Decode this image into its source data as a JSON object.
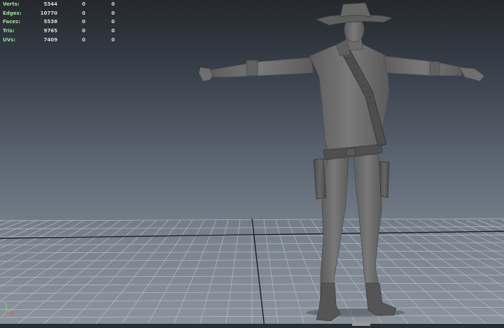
{
  "stats": [
    {
      "label": "Verts:",
      "values": [
        "5344",
        "0",
        "0"
      ]
    },
    {
      "label": "Edges:",
      "values": [
        "10770",
        "0",
        "0"
      ]
    },
    {
      "label": "Faces:",
      "values": [
        "5538",
        "0",
        "0"
      ]
    },
    {
      "label": "Tris:",
      "values": [
        "9765",
        "0",
        "0"
      ]
    },
    {
      "label": "UVs:",
      "values": [
        "7409",
        "0",
        "0"
      ]
    }
  ],
  "gizmo": {
    "y_label": "Y",
    "x_label": "X",
    "icon": "axis-gizmo-icon"
  },
  "colors": {
    "background_top": "#25282d",
    "background_bottom": "#8b949d",
    "grid": "#c9ced4",
    "model": "#6b6b6b",
    "hud_label": "#9fe29f",
    "hud_value": "#dcdcdc"
  }
}
